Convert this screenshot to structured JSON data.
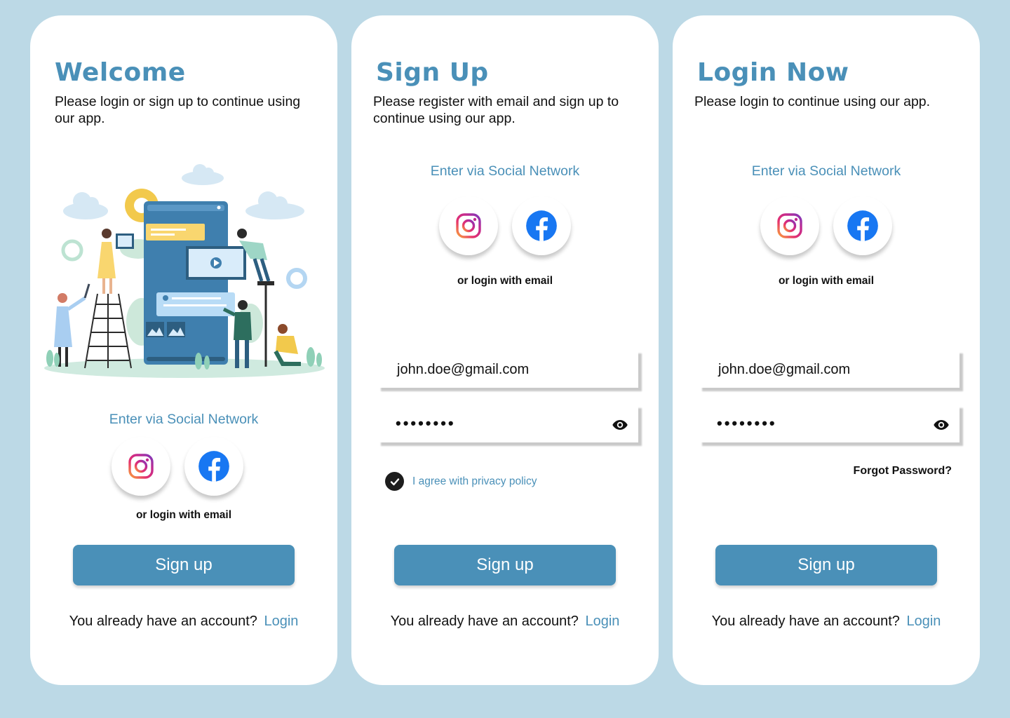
{
  "colors": {
    "background": "#bcd9e6",
    "accent": "#4a90b8",
    "card": "#ffffff",
    "text": "#111111"
  },
  "screens": [
    {
      "title": "Welcome",
      "subtitle": "Please login or sign up to continue using our app.",
      "illustration": "team-building-mobile-app-illustration",
      "social_label": "Enter via Social Network",
      "social": [
        {
          "icon": "instagram-icon"
        },
        {
          "icon": "facebook-icon"
        }
      ],
      "or_email": "or login with email",
      "primary_button": "Sign up",
      "account_text": "You already have an account?",
      "login_link": "Login"
    },
    {
      "title": "Sign Up",
      "subtitle": "Please register with email and sign up to continue using our app.",
      "social_label": "Enter via Social Network",
      "social": [
        {
          "icon": "instagram-icon"
        },
        {
          "icon": "facebook-icon"
        }
      ],
      "or_email": "or login with email",
      "email_value": "john.doe@gmail.com",
      "password_mask": "••••••••",
      "agree_checked": true,
      "agree_text": "I agree with privacy policy",
      "primary_button": "Sign up",
      "account_text": "You already have an account?",
      "login_link": "Login"
    },
    {
      "title": "Login Now",
      "subtitle": "Please login to continue using our app.",
      "social_label": "Enter via Social Network",
      "social": [
        {
          "icon": "instagram-icon"
        },
        {
          "icon": "facebook-icon"
        }
      ],
      "or_email": "or login with email",
      "email_value": "john.doe@gmail.com",
      "password_mask": "••••••••",
      "forgot_password": "Forgot Password?",
      "primary_button": "Sign up",
      "account_text": "You already have an account?",
      "login_link": "Login"
    }
  ]
}
